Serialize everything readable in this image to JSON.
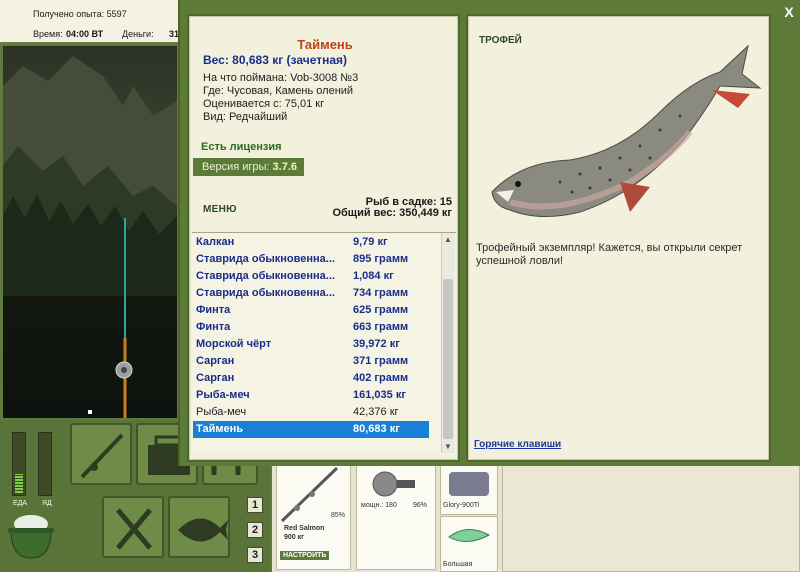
{
  "hud": {
    "xp_text": "Получено опыта: 5597",
    "time_label": "Время:",
    "time_value": "04:00 ВТ",
    "money_label": "Деньги:",
    "money_value": "31"
  },
  "meters": {
    "food_label": "ЕДА",
    "poison_label": "ЯД",
    "food_level": 0.3,
    "poison_level": 0.0
  },
  "pages": [
    "1",
    "2",
    "3"
  ],
  "inventory": {
    "rod_name": "Red Salmon",
    "rod_weight": "900 кг",
    "rod_percent": "85%",
    "setup_button": "НАСТРОИТЬ",
    "reel_text": "мощн.: 180",
    "reel_percent": "96%",
    "line_name": "Glory-900Ti",
    "bait_name": "Большая"
  },
  "modal": {
    "fish_name": "Таймень",
    "weight_text": "Вес: 80,683 кг (зачетная)",
    "caught_on": "На что поймана: Vob-3008 №3",
    "location": "Где: Чусовая, Камень олений",
    "valued": "Оценивается с: 75,01 кг",
    "rarity": "Вид: Редчайший",
    "license": "Есть лицензия",
    "version_label": "Версия игры: ",
    "version_value": "3.7.6",
    "menu_label": "МЕНЮ",
    "cage_count": "Рыб в садке: 15",
    "cage_weight": "Общий вес: 350,449 кг",
    "trophy_title": "ТРОФЕЙ",
    "trophy_text": "Трофейный экземпляр! Кажется, вы открыли секрет успешной ловли!",
    "hotkeys": "Горячие клавиши",
    "close": "X"
  },
  "catches": [
    {
      "name": "Калкан",
      "weight": "9,79 кг",
      "style": "bold"
    },
    {
      "name": "Ставрида обыкновенна...",
      "weight": "895 грамм",
      "style": "bold"
    },
    {
      "name": "Ставрида обыкновенна...",
      "weight": "1,084 кг",
      "style": "bold"
    },
    {
      "name": "Ставрида обыкновенна...",
      "weight": "734 грамм",
      "style": "bold"
    },
    {
      "name": "Финта",
      "weight": "625 грамм",
      "style": "bold"
    },
    {
      "name": "Финта",
      "weight": "663 грамм",
      "style": "bold"
    },
    {
      "name": "Морской чёрт",
      "weight": "39,972 кг",
      "style": "bold"
    },
    {
      "name": "Сарган",
      "weight": "371 грамм",
      "style": "bold"
    },
    {
      "name": "Сарган",
      "weight": "402 грамм",
      "style": "bold"
    },
    {
      "name": "Рыба-меч",
      "weight": "161,035 кг",
      "style": "bold"
    },
    {
      "name": "Рыба-меч",
      "weight": "42,376 кг",
      "style": "plain"
    },
    {
      "name": "Таймень",
      "weight": "80,683 кг",
      "style": "selected"
    }
  ]
}
